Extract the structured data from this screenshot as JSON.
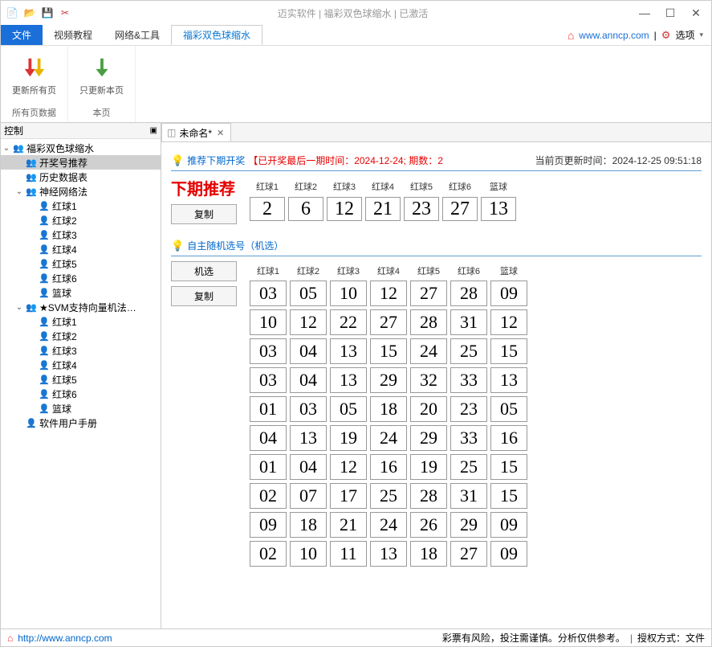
{
  "window": {
    "title": "迈实软件 | 福彩双色球缩水 | 已激活"
  },
  "menubar": {
    "file": "文件",
    "tabs": [
      "视频教程",
      "网络&工具",
      "福彩双色球缩水"
    ],
    "active_tab_index": 2,
    "url": "www.anncp.com",
    "options": "选项"
  },
  "ribbon": {
    "group1": {
      "btn": "更新所有页",
      "label": "所有页数据"
    },
    "group2": {
      "btn": "只更新本页",
      "label": "本页"
    }
  },
  "sidebar": {
    "title": "控制",
    "root": {
      "label": "福彩双色球缩水",
      "expanded": true
    },
    "children": [
      {
        "label": "开奖号推荐",
        "selected": true,
        "icon": "people"
      },
      {
        "label": "历史数据表",
        "icon": "people"
      },
      {
        "label": "神经网络法",
        "icon": "people",
        "expanded": true,
        "children": [
          "红球1",
          "红球2",
          "红球3",
          "红球4",
          "红球5",
          "红球6",
          "篮球"
        ]
      },
      {
        "label": "★SVM支持向量机法…",
        "icon": "people",
        "expanded": true,
        "star": true,
        "children": [
          "红球1",
          "红球2",
          "红球3",
          "红球4",
          "红球5",
          "红球6",
          "篮球"
        ]
      },
      {
        "label": "软件用户手册",
        "icon": "user"
      }
    ]
  },
  "doc": {
    "tab": "未命名*"
  },
  "main": {
    "sec1": {
      "link": "推荐下期开奖",
      "red": "【已开奖最后一期时间：2024-12-24; 期数：2",
      "update_label": "当前页更新时间：",
      "update_time": "2024-12-25 09:51:18",
      "title": "下期推荐",
      "btn_copy": "复制",
      "headers": [
        "红球1",
        "红球2",
        "红球3",
        "红球4",
        "红球5",
        "红球6",
        "篮球"
      ],
      "row": [
        "2",
        "6",
        "12",
        "21",
        "23",
        "27",
        "13"
      ]
    },
    "sec2": {
      "link": "自主随机选号（机选）",
      "btn_pick": "机选",
      "btn_copy": "复制",
      "headers": [
        "红球1",
        "红球2",
        "红球3",
        "红球4",
        "红球5",
        "红球6",
        "篮球"
      ],
      "rows": [
        [
          "03",
          "05",
          "10",
          "12",
          "27",
          "28",
          "09"
        ],
        [
          "10",
          "12",
          "22",
          "27",
          "28",
          "31",
          "12"
        ],
        [
          "03",
          "04",
          "13",
          "15",
          "24",
          "25",
          "15"
        ],
        [
          "03",
          "04",
          "13",
          "29",
          "32",
          "33",
          "13"
        ],
        [
          "01",
          "03",
          "05",
          "18",
          "20",
          "23",
          "05"
        ],
        [
          "04",
          "13",
          "19",
          "24",
          "29",
          "33",
          "16"
        ],
        [
          "01",
          "04",
          "12",
          "16",
          "19",
          "25",
          "15"
        ],
        [
          "02",
          "07",
          "17",
          "25",
          "28",
          "31",
          "15"
        ],
        [
          "09",
          "18",
          "21",
          "24",
          "26",
          "29",
          "09"
        ],
        [
          "02",
          "10",
          "11",
          "13",
          "18",
          "27",
          "09"
        ]
      ]
    }
  },
  "status": {
    "url": "http://www.anncp.com",
    "warn": "彩票有风险，投注需谨慎。分析仅供参考。",
    "auth": "授权方式：文件"
  }
}
